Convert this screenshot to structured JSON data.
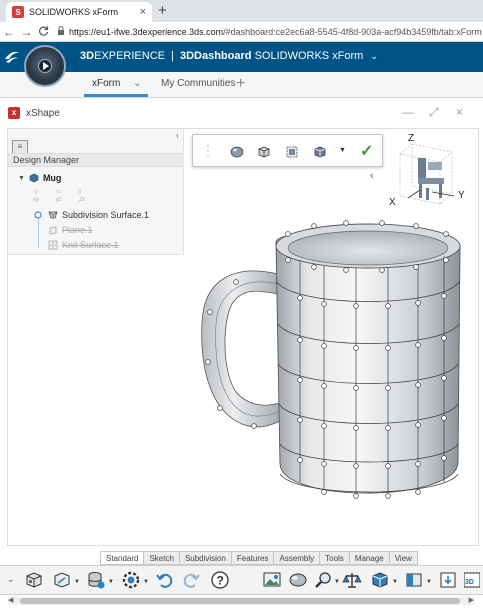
{
  "browser": {
    "tab_title": "SOLIDWORKS xForm",
    "tab_close": "×",
    "new_tab": "+",
    "url_host": "https://eu1-ifwe.3dexperience.3ds.com",
    "url_path": "/#dashboard:ce2ec6a8-5545-4f8d-903a-acf94b3459fb/tab:xForm",
    "nav": {
      "back": "←",
      "forward": "→",
      "reload": "C"
    }
  },
  "header": {
    "brand_3d": "3D",
    "brand_experience": "EXPERIENCE",
    "separator": "|",
    "dashboard": "3DDashboard",
    "app": "SOLIDWORKS xForm",
    "chevron": "⌄"
  },
  "dashboard_tabs": {
    "items": [
      {
        "label": "xForm",
        "active": true
      },
      {
        "label": "My Communities",
        "active": false
      }
    ],
    "tab_chevron": "⌄",
    "add": "+"
  },
  "widget": {
    "title": "xShape",
    "icon_letter": "x",
    "minimize": "—",
    "maximize": "⤢",
    "close": "×"
  },
  "design_manager": {
    "header": "Design Manager",
    "root": "Mug",
    "planes": [
      "xy",
      "yz",
      "zx"
    ],
    "items": [
      {
        "label": "Subdivision Surface.1",
        "hidden": false
      },
      {
        "label": "Plane.1",
        "hidden": true
      },
      {
        "label": "Knit Surface.1",
        "hidden": true
      }
    ],
    "collapse": "‹"
  },
  "triad": {
    "z": "Z",
    "x": "X",
    "y": "Y"
  },
  "section_tabs": [
    "Standard",
    "Sketch",
    "Subdivision",
    "Features",
    "Assembly",
    "Tools",
    "Manage",
    "View"
  ],
  "active_section": "Standard",
  "toolbar": {
    "left_chevron": "⌄",
    "icons": [
      "part-icon",
      "3d-sketch-icon",
      "database-icon",
      "settings-icon",
      "undo-icon",
      "redo-icon",
      "help-icon",
      "image-icon",
      "sphere-icon",
      "search-icon",
      "balance-icon",
      "view-icon",
      "section-icon",
      "export-icon",
      "3ds-icon"
    ]
  },
  "colors": {
    "brand_blue": "#005386",
    "accent": "#368ec4",
    "check_green": "#3a9a3a"
  }
}
